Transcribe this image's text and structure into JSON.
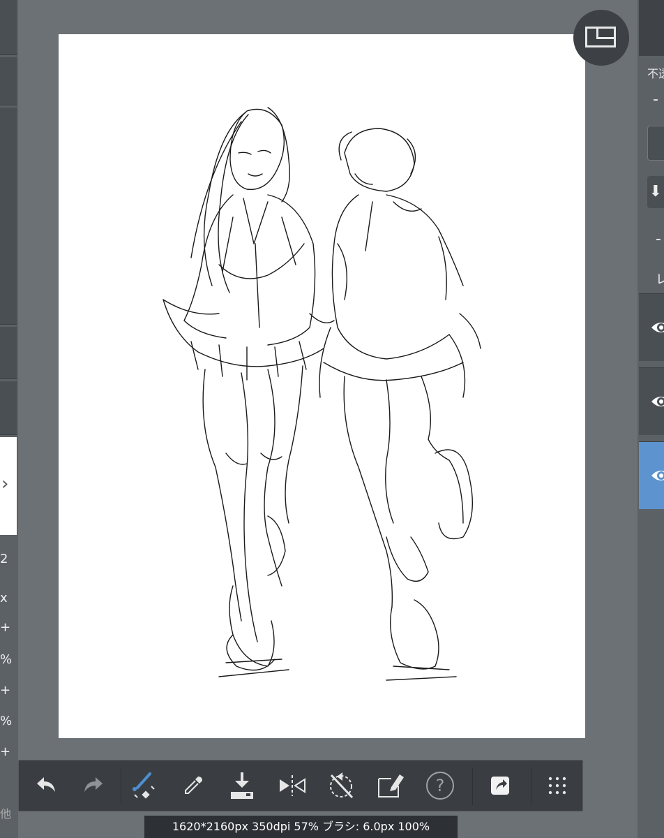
{
  "status_bar": {
    "text": "1620*2160px 350dpi 57% ブラシ: 6.0px 100%"
  },
  "left_panel": {
    "values": [
      "2",
      "x",
      "+",
      "%",
      "+",
      "%",
      "+"
    ],
    "bottom_label": "他"
  },
  "right_panel": {
    "top_label": "不透明度",
    "dash": "-",
    "dash2": "-",
    "label2": "レイヤー"
  },
  "toolbar": {
    "tools": [
      "undo-icon",
      "redo-icon",
      "brush-size-icon",
      "eyedropper-icon",
      "save-icon",
      "flip-horizontal-icon",
      "rotate-reset-icon",
      "edit-frame-icon",
      "help-icon",
      "share-icon",
      "menu-grid-icon"
    ]
  },
  "colors": {
    "accent": "#5d93cf",
    "background": "#6c7176",
    "toolbar": "#3a3e42"
  }
}
